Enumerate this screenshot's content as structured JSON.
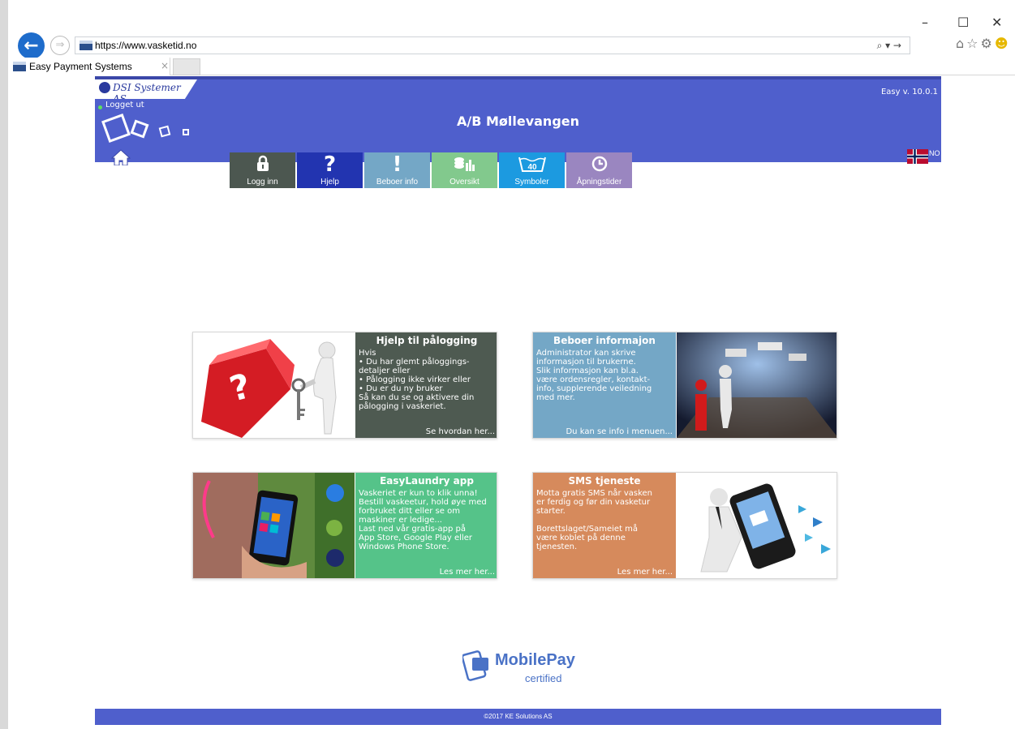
{
  "browser": {
    "url": "https://www.vasketid.no",
    "search_icon": "⌕ ▾ →",
    "tab_title": "Easy Payment Systems",
    "tab_close": "×",
    "window_controls": {
      "minimize": "–",
      "maximize": "☐",
      "close": "✕"
    },
    "toolbar_icons": [
      "home-icon",
      "star-icon",
      "gear-icon",
      "smiley-icon"
    ]
  },
  "header": {
    "logo": "DSI Systemer AS",
    "status": "Logget ut",
    "version": "Easy v. 10.0.1",
    "title": "A/B Møllevangen",
    "flag_language": "NO",
    "colors": {
      "bar": "#4f5fcc",
      "status_dot": "#5ce15c"
    }
  },
  "nav": [
    {
      "label": "Logg inn",
      "icon": "lock-icon",
      "glyph": "🔒",
      "color": "#4c5750"
    },
    {
      "label": "Hjelp",
      "icon": "question-icon",
      "glyph": "?",
      "color": "#2234b0"
    },
    {
      "label": "Beboer info",
      "icon": "exclamation-icon",
      "glyph": "!",
      "color": "#74a7c6"
    },
    {
      "label": "Oversikt",
      "icon": "chart-icon",
      "glyph": "≡",
      "color": "#82c98d"
    },
    {
      "label": "Symboler",
      "icon": "wash-40-icon",
      "glyph": "40",
      "color": "#1c9ae0"
    },
    {
      "label": "Åpningstider",
      "icon": "clock-icon",
      "glyph": "⏱",
      "color": "#9a86c0"
    }
  ],
  "tiles": {
    "help": {
      "title": "Hjelp til pålogging",
      "body": "Hvis\n• Du har glemt påloggings-\n   detaljer eller\n• Pålogging ikke virker eller\n• Du er du ny bruker\nSå kan du se og aktivere din\npålogging i vaskeriet.",
      "link": "Se hvordan her...",
      "color": "#4e5a51"
    },
    "resident": {
      "title": "Beboer informajon",
      "body": "Administrator kan skrive\ninformasjon til brukerne.\nSlik informasjon kan bl.a.\nvære ordensregler, kontakt-\ninfo, supplerende veiledning\nmed mer.",
      "link": "Du kan se info i menuen...",
      "color": "#74a7c6"
    },
    "app": {
      "title": "EasyLaundry app",
      "body": "Vaskeriet er kun to klik unna!\nBestill vaskeetur, hold øye med\nforbruket ditt eller se om\nmaskiner er ledige...\nLast ned vår gratis-app på\nApp Store, Google Play eller\nWindows Phone Store.",
      "link": "Les mer her...",
      "color": "#55c389"
    },
    "sms": {
      "title": "SMS tjeneste",
      "body": "Motta gratis SMS når vasken\ner ferdig og før din vasketur\nstarter.\n\nBorettslaget/Sameiet må\nvære koblet på denne\ntjenesten.",
      "link": "Les mer her...",
      "color": "#d68a5c"
    }
  },
  "mobilepay": {
    "name": "MobilePay",
    "sub": "certified"
  },
  "footer": {
    "copyright": "©2017 KE Solutions AS"
  }
}
